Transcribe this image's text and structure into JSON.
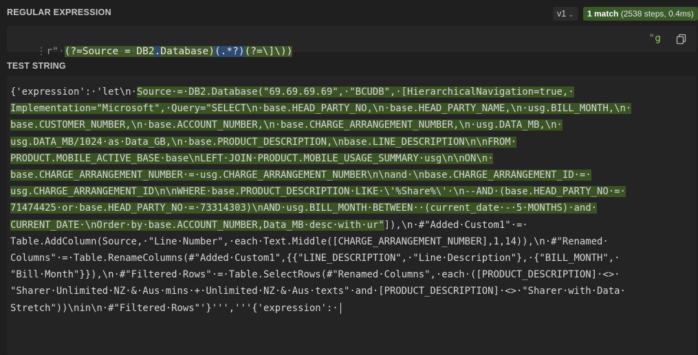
{
  "regex_section": {
    "label": "REGULAR EXPRESSION",
    "version": "v1",
    "match_summary_bold": "1 match",
    "match_summary_rest": " (2538 steps, 0.4ms)",
    "prefix": "r\"",
    "parts": {
      "lookahead_open": "(?=",
      "source_word": "Source",
      "equals": "=",
      "db2": "DB2",
      "dot_escaped": ".",
      "database": "Database",
      "lookahead_close": ")",
      "capture": "(.*?)",
      "lookahead2": "(?=\\]\\))"
    },
    "delimiter_close": "\"",
    "flags": "g",
    "copy_icon": "copy-icon"
  },
  "test_section": {
    "label": "TEST STRING",
    "lines": [
      {
        "pre": "{'expression':·'let\\n·",
        "match": "Source·=·DB2.Database(\"69.69.69.69\",·\"BCUDB\",·[HierarchicalNavigation=true,·",
        "post": ""
      },
      {
        "pre": "",
        "match": "Implementation=\"Microsoft\",·Query=\"SELECT\\n·base.HEAD_PARTY_NO,\\n·base.HEAD_PARTY_NAME,\\n·usg.BILL_MONTH,\\n·",
        "post": ""
      },
      {
        "pre": "",
        "match": "base.CUSTOMER_NUMBER,\\n·base.ACCOUNT_NUMBER,\\n·base.CHARGE_ARRANGEMENT_NUMBER,\\n·usg.DATA_MB,\\n·",
        "post": ""
      },
      {
        "pre": "",
        "match": "usg.DATA_MB/1024·as·Data_GB,\\n·base.PRODUCT_DESCRIPTION,\\nbase.LINE_DESCRIPTION\\n\\nFROM·",
        "post": ""
      },
      {
        "pre": "",
        "match": "PRODUCT.MOBILE_ACTIVE_BASE·base\\nLEFT·JOIN·PRODUCT.MOBILE_USAGE_SUMMARY·usg\\n\\nON\\n·",
        "post": ""
      },
      {
        "pre": "",
        "match": "base.CHARGE_ARRANGEMENT_NUMBER·=·usg.CHARGE_ARRANGEMENT_NUMBER\\n\\nand·\\nbase.CHARGE_ARRANGEMENT_ID·=·",
        "post": ""
      },
      {
        "pre": "",
        "match": "usg.CHARGE_ARRANGEMENT_ID\\n\\nWHERE·base.PRODUCT_DESCRIPTION·LIKE·\\'%Share%\\'·\\n--AND·(base.HEAD_PARTY_NO·=·",
        "post": ""
      },
      {
        "pre": "",
        "match": "71474425·or·base.HEAD_PARTY_NO·=·73314303)\\nAND·usg.BILL_MONTH·BETWEEN··(current_date·-·5·MONTHS)·and·",
        "post": ""
      },
      {
        "pre": "",
        "match": "CURRENT_DATE·\\nOrder·by·base.ACCOUNT_NUMBER,Data_MB·desc·with·ur\"",
        "post": "]),\\n·#\"Added·Custom1\"·=·"
      },
      {
        "pre": "",
        "match": "",
        "post": "Table.AddColumn(Source,·\"Line·Number\",·each·Text.Middle([CHARGE_ARRANGEMENT_NUMBER],1,14)),\\n·#\"Renamed·"
      },
      {
        "pre": "",
        "match": "",
        "post": "Columns\"·=·Table.RenameColumns(#\"Added·Custom1\",{{\"LINE_DESCRIPTION\",·\"Line·Description\"},·{\"BILL_MONTH\",·"
      },
      {
        "pre": "",
        "match": "",
        "post": "\"Bill·Month\"}}),\\n·#\"Filtered·Rows\"·=·Table.SelectRows(#\"Renamed·Columns\",·each·([PRODUCT_DESCRIPTION]·<>·"
      },
      {
        "pre": "",
        "match": "",
        "post": "\"Sharer·Unlimited·NZ·&·Aus·mins·+·Unlimited·NZ·&·Aus·texts\"·and·[PRODUCT_DESCRIPTION]·<>·\"Sharer·with·Data·"
      },
      {
        "pre": "",
        "match": "",
        "post": "Stretch\"))\\nin\\n·#\"Filtered·Rows\"'}''','''{'expression':·"
      }
    ]
  },
  "colors": {
    "background": "#1f1f1f",
    "match_highlight": "#3c5425",
    "match_badge": "#3a5a2a",
    "escape_highlight": "#2c4b6e"
  }
}
